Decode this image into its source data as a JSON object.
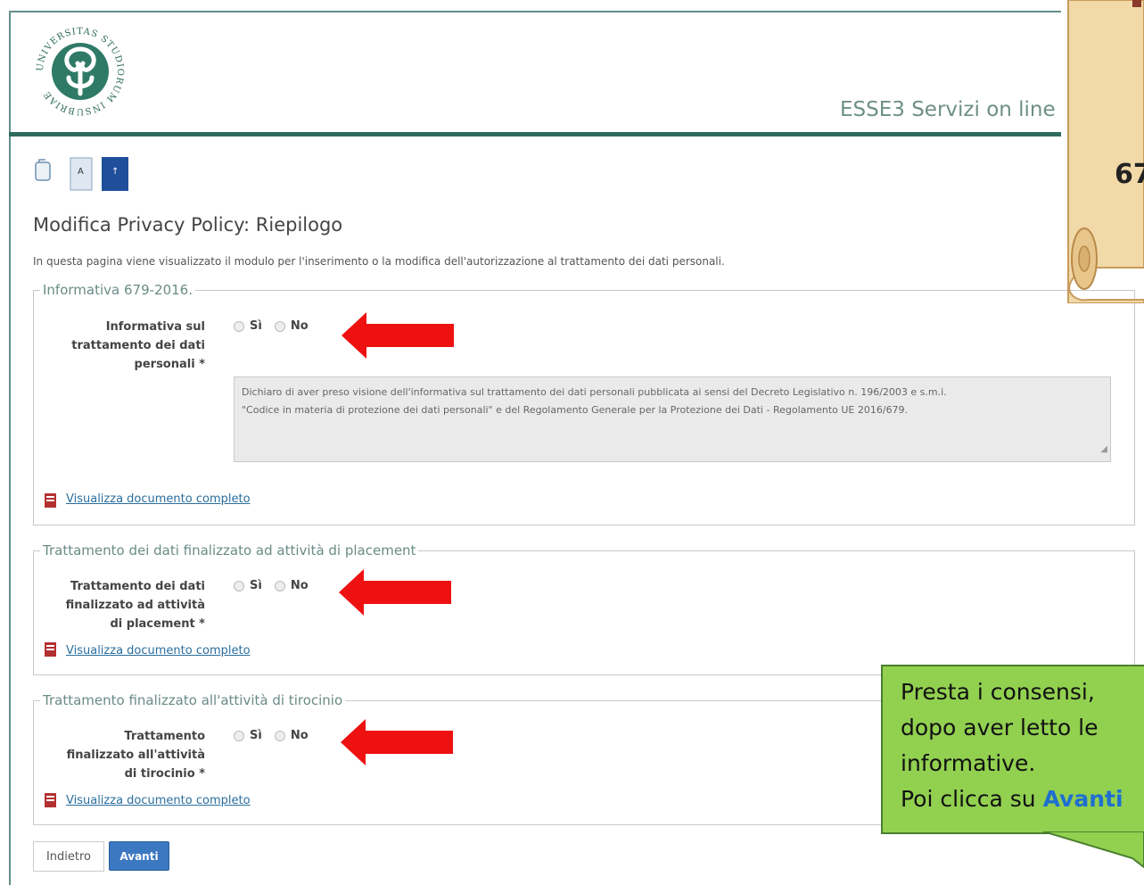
{
  "header": {
    "university_seal_text": "UNIVERSITAS STUDIORUM INSUBRIAE",
    "service_title": "ESSE3 Servizi on line"
  },
  "toolbar": {
    "font_small_label": "A",
    "font_large_label": "↑"
  },
  "page": {
    "title": "Modifica Privacy Policy: Riepilogo",
    "intro": "In questa pagina viene visualizzato il modulo per l'inserimento o la modifica dell'autorizzazione al trattamento dei dati personali."
  },
  "sections": [
    {
      "legend": "Informativa 679-2016.",
      "field_label_lines": [
        "Informativa sul",
        "trattamento dei dati",
        "personali *"
      ],
      "yes_label": "Sì",
      "no_label": "No",
      "text_line1": "Dichiaro di aver preso visione dell'informativa sul trattamento dei dati personali pubblicata ai sensi del Decreto Legislativo n. 196/2003 e s.m.i.",
      "text_line2": "\"Codice in materia di protezione dei dati personali\" e del Regolamento Generale per la Protezione dei Dati - Regolamento UE 2016/679.",
      "link": "Visualizza documento completo"
    },
    {
      "legend": "Trattamento dei dati finalizzato ad attività di placement",
      "field_label_lines": [
        "Trattamento dei dati",
        "finalizzato ad attività",
        "di placement *"
      ],
      "yes_label": "Sì",
      "no_label": "No",
      "link": "Visualizza documento completo"
    },
    {
      "legend": "Trattamento finalizzato all'attività di tirocinio",
      "field_label_lines": [
        "Trattamento",
        "finalizzato all'attività",
        "di tirocinio *"
      ],
      "yes_label": "Sì",
      "no_label": "No",
      "link": "Visualizza documento completo"
    }
  ],
  "buttons": {
    "back": "Indietro",
    "next": "Avanti"
  },
  "overlay": {
    "scroll_number": "67",
    "callout_lines": [
      "Presta i consensi,",
      "dopo aver letto le",
      "informative."
    ],
    "callout_last_prefix": "Poi clicca su ",
    "callout_last_highlight": "Avanti"
  },
  "colors": {
    "brand_green": "#2f6b5d",
    "callout_green": "#92d050",
    "arrow_red": "#ee1111",
    "primary_button": "#3b78c1"
  }
}
